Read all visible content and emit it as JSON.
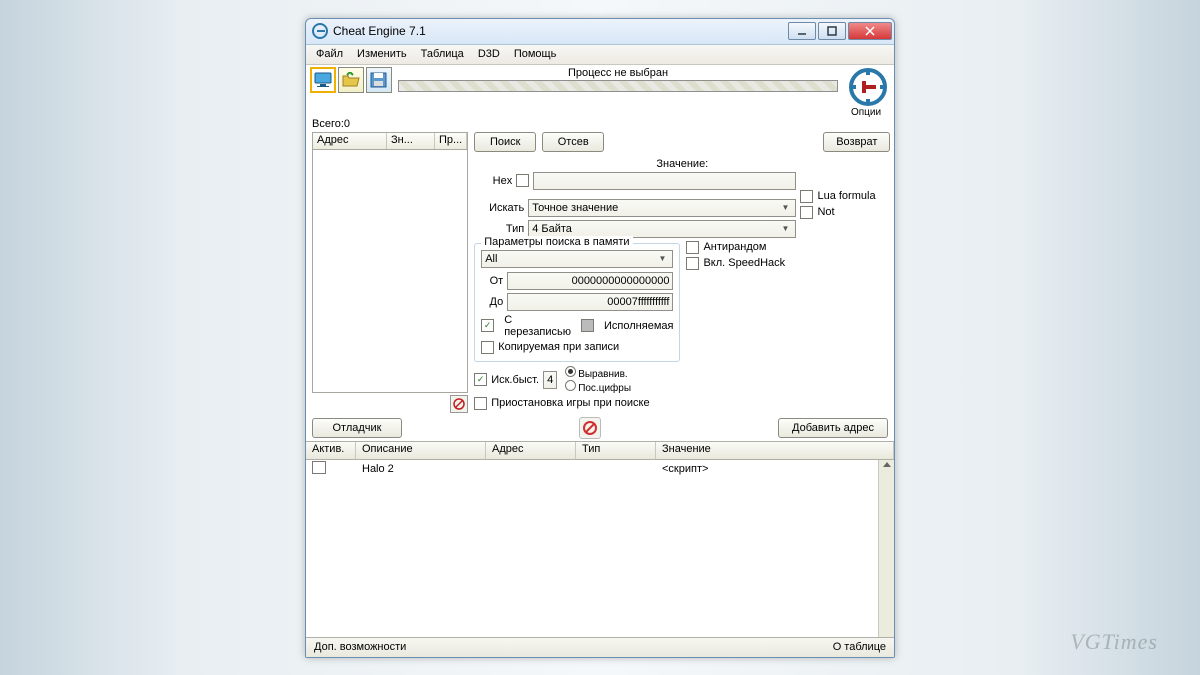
{
  "window": {
    "title": "Cheat Engine 7.1"
  },
  "menu": {
    "file": "Файл",
    "edit": "Изменить",
    "table": "Таблица",
    "d3d": "D3D",
    "help": "Помощь"
  },
  "toolbar": {
    "processLabel": "Процесс не выбран",
    "optionsLabel": "Опции"
  },
  "total": {
    "label": "Всего:",
    "value": "0"
  },
  "leftCols": {
    "addr": "Адрес",
    "val": "Зн...",
    "prev": "Пр..."
  },
  "scan": {
    "search": "Поиск",
    "filter": "Отсев",
    "undo": "Возврат",
    "valueLabel": "Значение:",
    "hexLabel": "Hex",
    "searchTypeLabel": "Искать",
    "searchTypeVal": "Точное значение",
    "dataTypeLabel": "Тип",
    "dataTypeVal": "4 Байта",
    "luaFormula": "Lua formula",
    "notLabel": "Not"
  },
  "mem": {
    "legend": "Параметры поиска в памяти",
    "region": "All",
    "fromLabel": "От",
    "fromVal": "0000000000000000",
    "toLabel": "До",
    "toVal": "00007fffffffffff",
    "writable": "С перезаписью",
    "executable": "Исполняемая",
    "copyOnWrite": "Копируемая при записи"
  },
  "opts": {
    "antiRandom": "Антирандом",
    "speedhack": "Вкл. SpeedHack",
    "fastScan": "Иск.быст.",
    "fastVal": "4",
    "alignment": "Выравнив.",
    "lastDigits": "Пос.цифры",
    "pauseGame": "Приостановка игры при поиске"
  },
  "below": {
    "debugger": "Отладчик",
    "addAddress": "Добавить адрес"
  },
  "tableCols": {
    "active": "Актив.",
    "desc": "Описание",
    "addr": "Адрес",
    "type": "Тип",
    "value": "Значение"
  },
  "rows": [
    {
      "desc": "Halo 2",
      "value": "<скрипт>"
    }
  ],
  "status": {
    "left": "Доп. возможности",
    "right": "О таблице"
  },
  "watermark": "VGTimes"
}
